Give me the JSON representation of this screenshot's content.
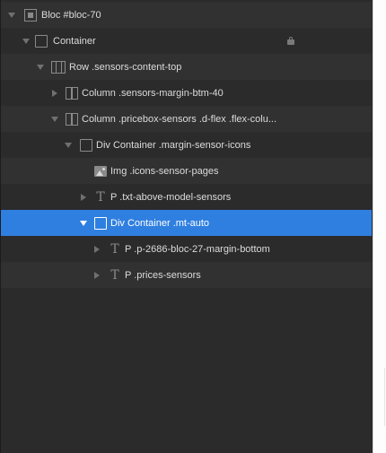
{
  "tree": {
    "bloc": {
      "label": "Bloc #bloc-70",
      "icon": "bloc-icon",
      "expanded": true
    },
    "container": {
      "label": "Container",
      "icon": "container-box-icon",
      "expanded": true,
      "locked": true
    },
    "row": {
      "label": "Row .sensors-content-top",
      "icon": "row-columns-icon",
      "expanded": true
    },
    "column1": {
      "label": "Column .sensors-margin-btm-40",
      "icon": "column-icon",
      "expanded": false
    },
    "column2": {
      "label": "Column .pricebox-sensors .d-flex .flex-colu...",
      "icon": "column-icon",
      "expanded": true
    },
    "div_icons": {
      "label": "Div Container .margin-sensor-icons",
      "icon": "container-box-icon",
      "expanded": true
    },
    "img": {
      "label": "Img .icons-sensor-pages",
      "icon": "image-icon"
    },
    "p_above": {
      "label": "P .txt-above-model-sensors",
      "icon": "text-icon",
      "expanded": false
    },
    "div_mt": {
      "label": "Div Container .mt-auto",
      "icon": "container-box-icon",
      "expanded": true,
      "selected": true
    },
    "p_margin": {
      "label": "P .p-2686-bloc-27-margin-bottom",
      "icon": "text-icon",
      "expanded": false
    },
    "p_prices": {
      "label": "P .prices-sensors",
      "icon": "text-icon",
      "expanded": false
    }
  },
  "glyphs": {
    "text_icon": "T"
  },
  "colors": {
    "panel_bg": "#2b2b2b",
    "row_alt_bg": "#313131",
    "selection": "#2f7fe0",
    "text": "#dcdcdc",
    "icon": "#8a8a8a"
  }
}
